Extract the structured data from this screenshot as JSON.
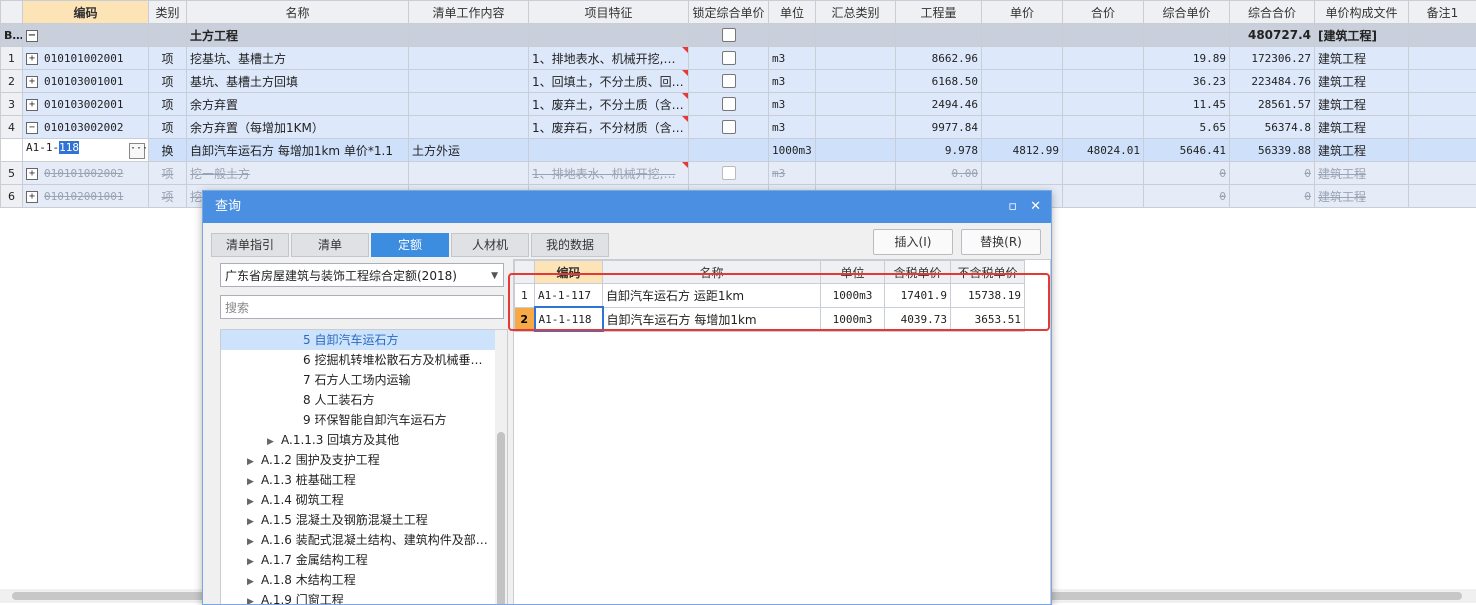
{
  "columns": [
    "编码",
    "类别",
    "名称",
    "清单工作内容",
    "项目特征",
    "锁定综合单价",
    "单位",
    "汇总类别",
    "工程量",
    "单价",
    "合价",
    "综合单价",
    "综合合价",
    "单价构成文件",
    "备注1"
  ],
  "group": {
    "rn": "B1",
    "name": "土方工程",
    "total": "480727.4",
    "file": "[建筑工程]"
  },
  "rows": [
    {
      "rn": "1",
      "code": "010101002001",
      "type": "项",
      "name": "挖基坑、基槽土方",
      "feature": "1、排地表水、机械开挖,…",
      "unit": "m3",
      "qty": "8662.96",
      "price": "",
      "amount": "",
      "up": "19.89",
      "total": "172306.27",
      "file": "建筑工程"
    },
    {
      "rn": "2",
      "code": "010103001001",
      "type": "项",
      "name": "基坑、基槽土方回填",
      "feature": "1、回填土，不分土质、回…",
      "unit": "m3",
      "qty": "6168.50",
      "price": "",
      "amount": "",
      "up": "36.23",
      "total": "223484.76",
      "file": "建筑工程"
    },
    {
      "rn": "3",
      "code": "010103002001",
      "type": "项",
      "name": "余方弃置",
      "feature": "1、废弃土，不分土质（含…",
      "unit": "m3",
      "qty": "2494.46",
      "price": "",
      "amount": "",
      "up": "11.45",
      "total": "28561.57",
      "file": "建筑工程"
    },
    {
      "rn": "4",
      "code": "010103002002",
      "type": "项",
      "name": "余方弃置（每增加1KM）",
      "feature": "1、废弃石，不分材质（含…",
      "unit": "m3",
      "qty": "9977.84",
      "price": "",
      "amount": "",
      "up": "5.65",
      "total": "56374.8",
      "file": "建筑工程"
    }
  ],
  "edit_row": {
    "code_prefix": "A1-1-",
    "code_sel": "118",
    "type": "换",
    "name": "自卸汽车运石方 每增加1km  单价*1.1",
    "work": "土方外运",
    "unit": "1000m3",
    "qty": "9.978",
    "price": "4812.99",
    "amount": "48024.01",
    "up": "5646.41",
    "total": "56339.88",
    "file": "建筑工程"
  },
  "del_rows": [
    {
      "rn": "5",
      "code": "010101002002",
      "type": "项",
      "name": "挖一般土方",
      "feature": "1、排地表水、机械开挖,…",
      "unit": "m3",
      "qty": "0.00",
      "up": "0",
      "total": "0",
      "file": "建筑工程"
    },
    {
      "rn": "6",
      "code": "010102001001",
      "type": "项",
      "name": "挖",
      "up": "0",
      "total": "0",
      "file": "建筑工程"
    }
  ],
  "dialog": {
    "title": "查询",
    "tabs": [
      "清单指引",
      "清单",
      "定额",
      "人材机",
      "我的数据"
    ],
    "insert": "插入(I)",
    "replace": "替换(R)",
    "library": "广东省房屋建筑与装饰工程综合定额(2018)",
    "search_placeholder": "搜索",
    "tree": [
      "5 自卸汽车运石方",
      "6 挖掘机转堆松散石方及机械垂…",
      "7 石方人工场内运输",
      "8 人工装石方",
      "9 环保智能自卸汽车运石方",
      "A.1.1.3 回填方及其他",
      "A.1.2 围护及支护工程",
      "A.1.3 桩基础工程",
      "A.1.4 砌筑工程",
      "A.1.5 混凝土及钢筋混凝土工程",
      "A.1.6 装配式混凝土结构、建筑构件及部…",
      "A.1.7 金属结构工程",
      "A.1.8 木结构工程",
      "A.1.9 门窗工程"
    ],
    "result_headers": [
      "编码",
      "名称",
      "单位",
      "含税单价",
      "不含税单价"
    ],
    "results": [
      {
        "rn": "1",
        "code": "A1-1-117",
        "name": "自卸汽车运石方 运距1km",
        "unit": "1000m3",
        "tax": "17401.9",
        "notax": "15738.19"
      },
      {
        "rn": "2",
        "code": "A1-1-118",
        "name": "自卸汽车运石方 每增加1km",
        "unit": "1000m3",
        "tax": "4039.73",
        "notax": "3653.51"
      }
    ]
  }
}
